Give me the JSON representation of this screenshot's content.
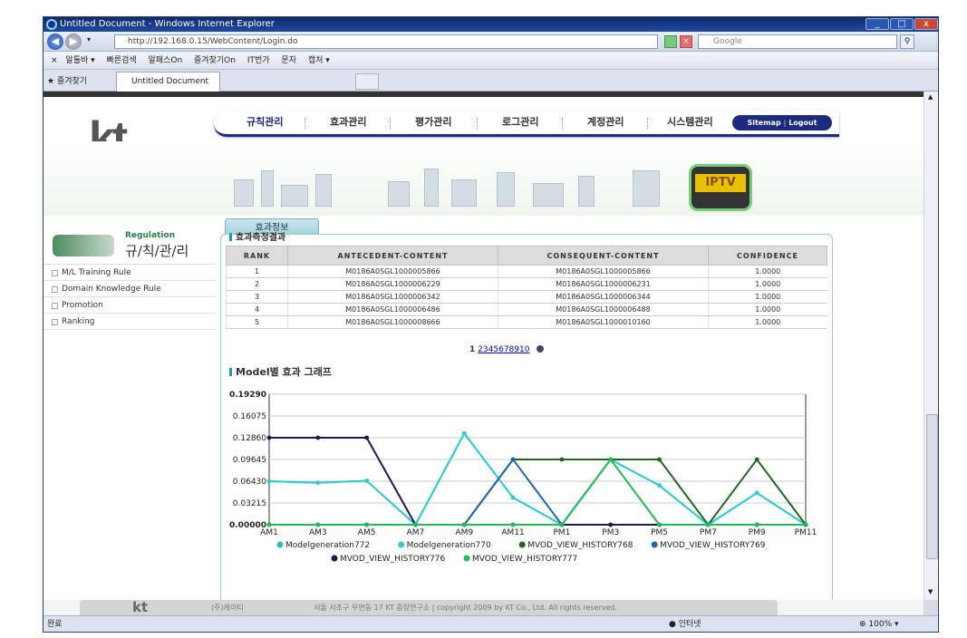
{
  "window": {
    "title": "Untitled Document - Windows Internet Explorer",
    "controls": [
      "_",
      "□",
      "x"
    ]
  },
  "address": {
    "url": "http://192.168.0.15/WebContent/Login.do",
    "search_placeholder": "Google"
  },
  "toolbar": {
    "items": [
      "알툴바 ▾",
      "빠른검색",
      "알패스On",
      "즐겨찾기On",
      "IT번가",
      "문자",
      "캡처 ▾"
    ]
  },
  "tabs": {
    "favorites": "즐겨찾기",
    "tab1": "Untitled Document"
  },
  "site": {
    "logo": "kt",
    "nav": [
      "규칙관리",
      "효과관리",
      "평가관리",
      "로그관리",
      "계정관리",
      "시스템관리"
    ],
    "sitemap": "Sitemap",
    "logout": "Logout",
    "iptv": "IPTV"
  },
  "sidebar": {
    "title_en": "Regulation",
    "title_ko": "규/칙/관/리",
    "items": [
      "M/L Training Rule",
      "Domain Knowledge Rule",
      "Promotion",
      "Ranking"
    ]
  },
  "panel": {
    "tab": "효과정보",
    "section1": "효과측정결과",
    "section2": "Model별 효과 그래프",
    "columns": [
      "RANK",
      "ANTECEDENT-CONTENT",
      "CONSEQUENT-CONTENT",
      "CONFIDENCE"
    ],
    "rows": [
      [
        "1",
        "M0186A0SGL1000005866",
        "M0186A0SGL1000005866",
        "1.0000"
      ],
      [
        "2",
        "M0186A0SGL1000006229",
        "M0186A0SGL1000006231",
        "1.0000"
      ],
      [
        "3",
        "M0186A0SGL1000006342",
        "M0186A0SGL1000006344",
        "1.0000"
      ],
      [
        "4",
        "M0186A0SGL1000006486",
        "M0186A0SGL1000006488",
        "1.0000"
      ],
      [
        "5",
        "M0186A0SGL1000008666",
        "M0186A0SGL1000010160",
        "1.0000"
      ]
    ],
    "pager": {
      "current": "1",
      "pages": [
        "2",
        "3",
        "4",
        "5",
        "6",
        "7",
        "8",
        "9",
        "10"
      ]
    }
  },
  "chart_data": {
    "type": "line",
    "title": "",
    "x": [
      "AM1",
      "AM3",
      "AM5",
      "AM7",
      "AM9",
      "AM11",
      "PM1",
      "PM3",
      "PM5",
      "PM7",
      "PM9",
      "PM11"
    ],
    "yticks": [
      "0.00000",
      "0.03215",
      "0.06430",
      "0.09645",
      "0.12860",
      "0.16075",
      "0.19290"
    ],
    "ylim": [
      0,
      0.1929
    ],
    "grid": true,
    "legend_position": "bottom",
    "series": [
      {
        "name": "Modelgeneration772",
        "color": "#33bbbb",
        "values": [
          0.0643,
          0.062,
          0.065,
          0.0,
          0.135,
          0.04,
          0.0,
          0.09645,
          0.058,
          0.0,
          0.047,
          0.0
        ]
      },
      {
        "name": "Modelgeneration770",
        "color": "#33cccc",
        "values": [
          0.0643,
          0.062,
          0.065,
          0.0,
          0.135,
          0.04,
          0.0,
          0.09645,
          0.058,
          0.0,
          0.047,
          0.0
        ]
      },
      {
        "name": "MVOD_VIEW_HISTORY768",
        "color": "#226622",
        "values": [
          0.0,
          0.0,
          0.0,
          0.0,
          0.0,
          0.09645,
          0.09645,
          0.09645,
          0.09645,
          0.0,
          0.09645,
          0.0
        ]
      },
      {
        "name": "MVOD_VIEW_HISTORY769",
        "color": "#2266aa",
        "values": [
          0.0,
          0.0,
          0.0,
          0.0,
          0.0,
          0.09645,
          0.0,
          0.0,
          0.0,
          0.0,
          0.0,
          0.0
        ]
      },
      {
        "name": "MVOD_VIEW_HISTORY776",
        "color": "#1a1a55",
        "values": [
          0.1286,
          0.1286,
          0.1286,
          0.0,
          0.0,
          0.0,
          0.0,
          0.0,
          0.0,
          0.0,
          0.0,
          0.0
        ]
      },
      {
        "name": "MVOD_VIEW_HISTORY777",
        "color": "#22bb55",
        "values": [
          0.0,
          0.0,
          0.0,
          0.0,
          0.0,
          0.0,
          0.0,
          0.09645,
          0.0,
          0.0,
          0.0,
          0.0
        ]
      }
    ]
  },
  "footer": {
    "logo": "kt",
    "company": "(주)케이티",
    "text": "서울 서초구 우면동 17 KT 중앙연구소  |  copyright 2009 by KT Co., Ltd. All rights reserved."
  },
  "status": {
    "left": "완료",
    "zone": "인터넷",
    "zoom": "100%"
  }
}
